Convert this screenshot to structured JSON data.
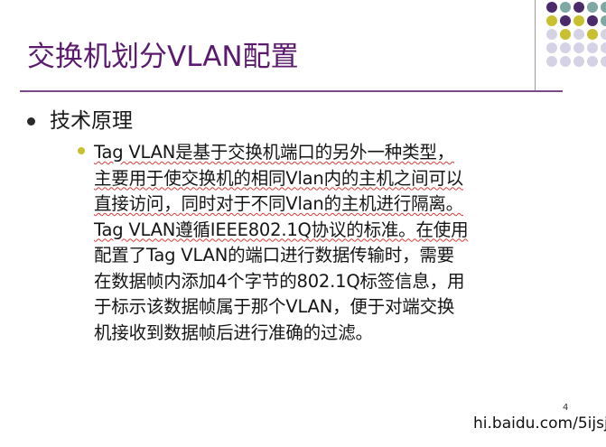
{
  "slide": {
    "title": "交换机划分VLAN配置",
    "page_number": "4",
    "watermark": "hi.baidu.com/5ijsj"
  },
  "bullets": {
    "level1": "技术原理",
    "level2_lines": [
      "Tag VLAN是基于交换机端口的另外一种类型，",
      "主要用于使交换机的相同Vlan内的主机之间可以",
      "直接访问，同时对于不同Vlan的主机进行隔离。",
      "Tag VLAN遵循IEEE802.1Q协议的标准。在使用",
      "配置了Tag VLAN的端口进行数据传输时，需要",
      "在数据帧内添加4个字节的802.1Q标签信息，用",
      "于标示该数据帧属于那个VLAN，便于对端交换",
      "机接收到数据帧后进行准确的过滤。"
    ]
  },
  "colors": {
    "title": "#5b1a6e",
    "accent_purple": "#4a2a6a",
    "accent_teal": "#7fa8a4",
    "accent_yellow": "#c8c030",
    "accent_lavender": "#d6d2e6",
    "spellcheck_underline": "#d93b3b"
  },
  "decor": {
    "dot_grid": [
      [
        "accent_purple",
        "accent_teal",
        "accent_purple",
        "accent_teal",
        "accent_teal"
      ],
      [
        "accent_yellow",
        "accent_purple",
        "accent_yellow",
        "accent_purple",
        "accent_teal"
      ],
      [
        "accent_lavender",
        "accent_yellow",
        "accent_lavender",
        "accent_yellow",
        "accent_lavender"
      ],
      [
        "accent_lavender",
        "accent_lavender",
        "accent_lavender",
        "accent_lavender",
        "accent_lavender"
      ],
      [
        "accent_lavender",
        "accent_lavender",
        "accent_lavender",
        "accent_lavender",
        "accent_lavender"
      ]
    ]
  }
}
